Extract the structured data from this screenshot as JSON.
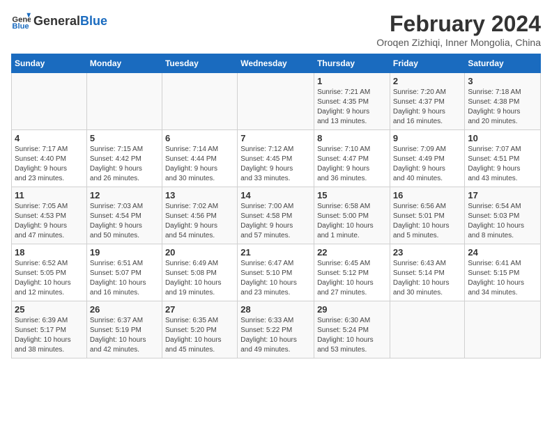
{
  "header": {
    "logo_general": "General",
    "logo_blue": "Blue",
    "title": "February 2024",
    "subtitle": "Oroqen Zizhiqi, Inner Mongolia, China"
  },
  "weekdays": [
    "Sunday",
    "Monday",
    "Tuesday",
    "Wednesday",
    "Thursday",
    "Friday",
    "Saturday"
  ],
  "weeks": [
    [
      {
        "day": "",
        "info": ""
      },
      {
        "day": "",
        "info": ""
      },
      {
        "day": "",
        "info": ""
      },
      {
        "day": "",
        "info": ""
      },
      {
        "day": "1",
        "info": "Sunrise: 7:21 AM\nSunset: 4:35 PM\nDaylight: 9 hours\nand 13 minutes."
      },
      {
        "day": "2",
        "info": "Sunrise: 7:20 AM\nSunset: 4:37 PM\nDaylight: 9 hours\nand 16 minutes."
      },
      {
        "day": "3",
        "info": "Sunrise: 7:18 AM\nSunset: 4:38 PM\nDaylight: 9 hours\nand 20 minutes."
      }
    ],
    [
      {
        "day": "4",
        "info": "Sunrise: 7:17 AM\nSunset: 4:40 PM\nDaylight: 9 hours\nand 23 minutes."
      },
      {
        "day": "5",
        "info": "Sunrise: 7:15 AM\nSunset: 4:42 PM\nDaylight: 9 hours\nand 26 minutes."
      },
      {
        "day": "6",
        "info": "Sunrise: 7:14 AM\nSunset: 4:44 PM\nDaylight: 9 hours\nand 30 minutes."
      },
      {
        "day": "7",
        "info": "Sunrise: 7:12 AM\nSunset: 4:45 PM\nDaylight: 9 hours\nand 33 minutes."
      },
      {
        "day": "8",
        "info": "Sunrise: 7:10 AM\nSunset: 4:47 PM\nDaylight: 9 hours\nand 36 minutes."
      },
      {
        "day": "9",
        "info": "Sunrise: 7:09 AM\nSunset: 4:49 PM\nDaylight: 9 hours\nand 40 minutes."
      },
      {
        "day": "10",
        "info": "Sunrise: 7:07 AM\nSunset: 4:51 PM\nDaylight: 9 hours\nand 43 minutes."
      }
    ],
    [
      {
        "day": "11",
        "info": "Sunrise: 7:05 AM\nSunset: 4:53 PM\nDaylight: 9 hours\nand 47 minutes."
      },
      {
        "day": "12",
        "info": "Sunrise: 7:03 AM\nSunset: 4:54 PM\nDaylight: 9 hours\nand 50 minutes."
      },
      {
        "day": "13",
        "info": "Sunrise: 7:02 AM\nSunset: 4:56 PM\nDaylight: 9 hours\nand 54 minutes."
      },
      {
        "day": "14",
        "info": "Sunrise: 7:00 AM\nSunset: 4:58 PM\nDaylight: 9 hours\nand 57 minutes."
      },
      {
        "day": "15",
        "info": "Sunrise: 6:58 AM\nSunset: 5:00 PM\nDaylight: 10 hours\nand 1 minute."
      },
      {
        "day": "16",
        "info": "Sunrise: 6:56 AM\nSunset: 5:01 PM\nDaylight: 10 hours\nand 5 minutes."
      },
      {
        "day": "17",
        "info": "Sunrise: 6:54 AM\nSunset: 5:03 PM\nDaylight: 10 hours\nand 8 minutes."
      }
    ],
    [
      {
        "day": "18",
        "info": "Sunrise: 6:52 AM\nSunset: 5:05 PM\nDaylight: 10 hours\nand 12 minutes."
      },
      {
        "day": "19",
        "info": "Sunrise: 6:51 AM\nSunset: 5:07 PM\nDaylight: 10 hours\nand 16 minutes."
      },
      {
        "day": "20",
        "info": "Sunrise: 6:49 AM\nSunset: 5:08 PM\nDaylight: 10 hours\nand 19 minutes."
      },
      {
        "day": "21",
        "info": "Sunrise: 6:47 AM\nSunset: 5:10 PM\nDaylight: 10 hours\nand 23 minutes."
      },
      {
        "day": "22",
        "info": "Sunrise: 6:45 AM\nSunset: 5:12 PM\nDaylight: 10 hours\nand 27 minutes."
      },
      {
        "day": "23",
        "info": "Sunrise: 6:43 AM\nSunset: 5:14 PM\nDaylight: 10 hours\nand 30 minutes."
      },
      {
        "day": "24",
        "info": "Sunrise: 6:41 AM\nSunset: 5:15 PM\nDaylight: 10 hours\nand 34 minutes."
      }
    ],
    [
      {
        "day": "25",
        "info": "Sunrise: 6:39 AM\nSunset: 5:17 PM\nDaylight: 10 hours\nand 38 minutes."
      },
      {
        "day": "26",
        "info": "Sunrise: 6:37 AM\nSunset: 5:19 PM\nDaylight: 10 hours\nand 42 minutes."
      },
      {
        "day": "27",
        "info": "Sunrise: 6:35 AM\nSunset: 5:20 PM\nDaylight: 10 hours\nand 45 minutes."
      },
      {
        "day": "28",
        "info": "Sunrise: 6:33 AM\nSunset: 5:22 PM\nDaylight: 10 hours\nand 49 minutes."
      },
      {
        "day": "29",
        "info": "Sunrise: 6:30 AM\nSunset: 5:24 PM\nDaylight: 10 hours\nand 53 minutes."
      },
      {
        "day": "",
        "info": ""
      },
      {
        "day": "",
        "info": ""
      }
    ]
  ]
}
